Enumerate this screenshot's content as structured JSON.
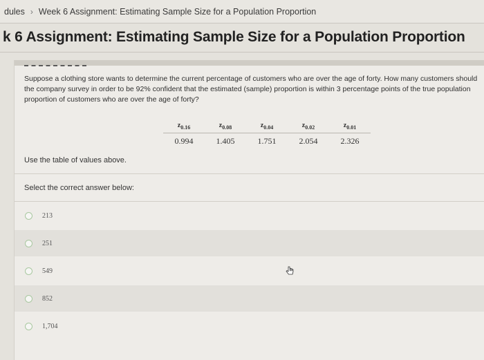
{
  "breadcrumb": {
    "items": [
      "dules",
      "Week 6 Assignment: Estimating Sample Size for a Population Proportion"
    ],
    "separator": "›"
  },
  "page_title": "k 6 Assignment: Estimating Sample Size for a Population Proportion",
  "question": {
    "text": "Suppose a clothing store wants to determine the current percentage of customers who are over the age of forty. How many customers should the company survey in order to be 92% confident that the estimated (sample) proportion is within 3 percentage points of the true population proportion of customers who are over the age of forty?"
  },
  "z_table": {
    "headers": [
      "z",
      "z",
      "z",
      "z",
      "z"
    ],
    "subscripts": [
      "0.16",
      "0.08",
      "0.04",
      "0.02",
      "0.01"
    ],
    "values": [
      "0.994",
      "1.405",
      "1.751",
      "2.054",
      "2.326"
    ]
  },
  "instruction": "Use the table of values above.",
  "prompt": "Select the correct answer below:",
  "options": [
    "213",
    "251",
    "549",
    "852",
    "1,704"
  ],
  "colors": {
    "radio_border": "#a9c8a0",
    "panel_bg": "#eeece8",
    "shaded_row": "#e2e0db"
  },
  "icons": {
    "cursor": "hand-pointer-icon"
  }
}
